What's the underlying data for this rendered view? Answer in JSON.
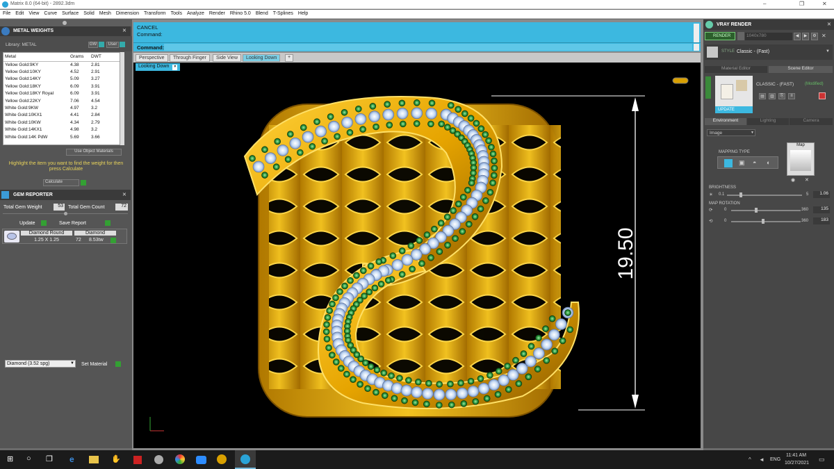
{
  "window": {
    "title": "Matrix 8.0 (64-bit) - 2892.3dm",
    "controls": [
      "–",
      "❐",
      "✕"
    ]
  },
  "menu": [
    "File",
    "Edit",
    "View",
    "Curve",
    "Surface",
    "Solid",
    "Mesh",
    "Dimension",
    "Transform",
    "Tools",
    "Analyze",
    "Render",
    "Rhino 5.0",
    "Blend",
    "T-Splines",
    "Help"
  ],
  "metal_weights": {
    "title": "METAL WEIGHTS",
    "library": "Library: METAL",
    "gw": "GW",
    "user": "User",
    "columns": [
      "Metal",
      "Grams",
      "DWT"
    ],
    "rows": [
      [
        "Yellow Gold:9KY",
        "4.38",
        "2.81"
      ],
      [
        "Yellow Gold:10KY",
        "4.52",
        "2.91"
      ],
      [
        "Yellow Gold:14KY",
        "5.09",
        "3.27"
      ],
      [
        "Yellow Gold:18KY",
        "6.09",
        "3.91"
      ],
      [
        "Yellow Gold:18KY Royal",
        "6.09",
        "3.91"
      ],
      [
        "Yellow Gold:22KY",
        "7.06",
        "4.54"
      ],
      [
        "White Gold:9KW",
        "4.97",
        "3.2"
      ],
      [
        "White Gold:10KX1",
        "4.41",
        "2.84"
      ],
      [
        "White Gold:10KW",
        "4.34",
        "2.79"
      ],
      [
        "White Gold:14KX1",
        "4.98",
        "3.2"
      ],
      [
        "White Gold:14K PdW",
        "5.69",
        "3.66"
      ]
    ],
    "use_object_materials": "Use Object Materials",
    "hint": "Highlight the item you want to find the weight for then press Calculate",
    "calculate": "Calculate"
  },
  "gem_reporter": {
    "title": "GEM REPORTER",
    "total_weight_label": "Total Gem Weight",
    "total_weight": "53",
    "total_count_label": "Total Gem Count",
    "total_count": "72",
    "update": "Update",
    "save_report": "Save Report",
    "gem_name": "Diamond Round",
    "gem_size": "1.25 X 1.25",
    "gem_material": "Diamond",
    "gem_count": "72",
    "gem_weight": "8.53tw"
  },
  "set_material": {
    "selected": "Diamond    (3.52 spg)",
    "button": "Set Material"
  },
  "command": {
    "line1": "CANCEL",
    "line2": "Command:",
    "prompt": "Command:"
  },
  "viewport_tabs": [
    "Perspective",
    "Through Finger",
    "Side View",
    "Looking Down"
  ],
  "active_view": "Looking Down",
  "dimension": "19.50",
  "vray": {
    "title": "VRAY RENDER",
    "render": "RENDER",
    "resolution": "1040x780",
    "style_label": "STYLE",
    "style": "Classic - (Fast)",
    "tab_material": "Material Editor",
    "tab_scene": "Scene Editor",
    "preset": "CLASSIC - (FAST)",
    "modified": "(Modified)",
    "update": "UPDATE",
    "env_tabs": [
      "Environment",
      "Lighting",
      "Camera"
    ],
    "env_type": "Image",
    "mapping_type": "MAPPING TYPE",
    "map": "Map",
    "brightness": "BRIGHTNESS",
    "brightness_min": "0.1",
    "brightness_max": "5",
    "brightness_val": "1.06",
    "map_rotation": "MAP ROTATION",
    "rot1_min": "0",
    "rot1_max": "360",
    "rot1_val": "135",
    "rot2_min": "0",
    "rot2_max": "360",
    "rot2_val": "183"
  },
  "taskbar": {
    "lang": "ENG",
    "time": "11:41 AM",
    "date": "10/27/2021"
  },
  "colors": {
    "gold": "#e0a800",
    "cmd_blue": "#3cb8e0",
    "panel": "#4a4a4a",
    "gem_green": "#2e9a3e",
    "diamond": "#b9d4f0"
  }
}
